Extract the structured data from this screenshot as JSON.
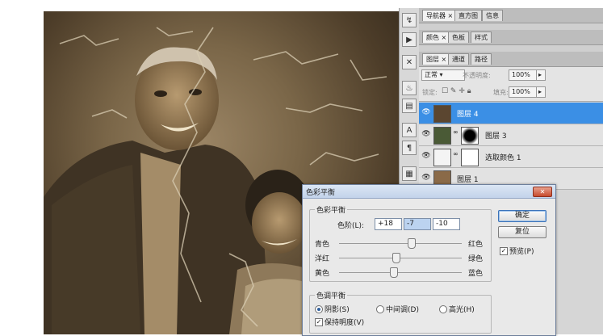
{
  "tool_icons": [
    "history-icon",
    "navigate-icon",
    "tools-icon",
    "stamp-icon",
    "swatch-icon",
    "character-icon",
    "paragraph-icon",
    "layer-comp-icon"
  ],
  "panel_groups": {
    "group1_tabs": [
      "导航器",
      "直方图",
      "信息"
    ],
    "group2_tabs": [
      "颜色",
      "色板",
      "样式"
    ],
    "group3_tabs": [
      "图层",
      "通道",
      "路径"
    ]
  },
  "layers_panel": {
    "blend_mode": "正常",
    "opacity_label": "不透明度:",
    "opacity_value": "100%",
    "lock_label": "锁定:",
    "fill_label": "填充:",
    "fill_value": "100%",
    "layers": [
      {
        "name": "图层 4",
        "selected": true
      },
      {
        "name": "图层 3",
        "selected": false
      },
      {
        "name": "选取颜色 1",
        "selected": false
      },
      {
        "name": "图层 1",
        "selected": false
      }
    ]
  },
  "dialog": {
    "title": "色彩平衡",
    "balance_group": "色彩平衡",
    "levels_label": "色阶(L):",
    "levels": [
      "+18",
      "-7",
      "-10"
    ],
    "sliders": [
      {
        "left": "青色",
        "right": "红色",
        "value": 18
      },
      {
        "left": "洋红",
        "right": "绿色",
        "value": -7
      },
      {
        "left": "黄色",
        "right": "蓝色",
        "value": -10
      }
    ],
    "tone_group": "色调平衡",
    "tones": [
      "阴影(S)",
      "中间调(D)",
      "高光(H)"
    ],
    "tone_selected": "阴影(S)",
    "preserve_luminosity": "保持明度(V)",
    "preserve_checked": true,
    "ok_label": "确定",
    "reset_label": "复位",
    "preview_label": "预览(P)",
    "preview_checked": true
  },
  "colors": {
    "selection": "#3b8fe5",
    "photo_tone": "#7a6648"
  }
}
